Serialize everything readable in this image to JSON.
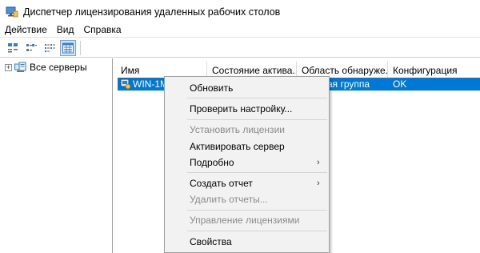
{
  "window": {
    "title": "Диспетчер лицензирования удаленных рабочих столов"
  },
  "menubar": {
    "items": [
      "Действие",
      "Вид",
      "Справка"
    ]
  },
  "toolbar": {
    "buttons": [
      "large-icons-view",
      "small-icons-view",
      "list-view",
      "details-view"
    ],
    "active_index": 3
  },
  "tree": {
    "root_label": "Все серверы",
    "expander": "+"
  },
  "list": {
    "columns": [
      "Имя",
      "Состояние актива...",
      "Область обнаруже...",
      "Конфигурация"
    ],
    "rows": [
      {
        "name": "WIN-1M",
        "status": "",
        "scope": "ая группа",
        "config": "OK",
        "selected": true
      }
    ]
  },
  "context_menu": {
    "items": [
      {
        "label": "Обновить",
        "enabled": true
      },
      {
        "label": "Проверить настройку...",
        "enabled": true
      },
      {
        "label": "Установить лицензии",
        "enabled": false
      },
      {
        "label": "Активировать сервер",
        "enabled": true
      },
      {
        "label": "Подробно",
        "enabled": true,
        "submenu": true
      },
      {
        "label": "Создать отчет",
        "enabled": true,
        "submenu": true
      },
      {
        "label": "Удалить отчеты...",
        "enabled": false
      },
      {
        "label": "Управление лицензиями",
        "enabled": false
      },
      {
        "label": "Свойства",
        "enabled": true
      }
    ],
    "submenu_arrow": "›"
  },
  "colors": {
    "selection": "#0078d7",
    "menu_bg": "#f2f2f2",
    "disabled_text": "#8a8a8a"
  }
}
